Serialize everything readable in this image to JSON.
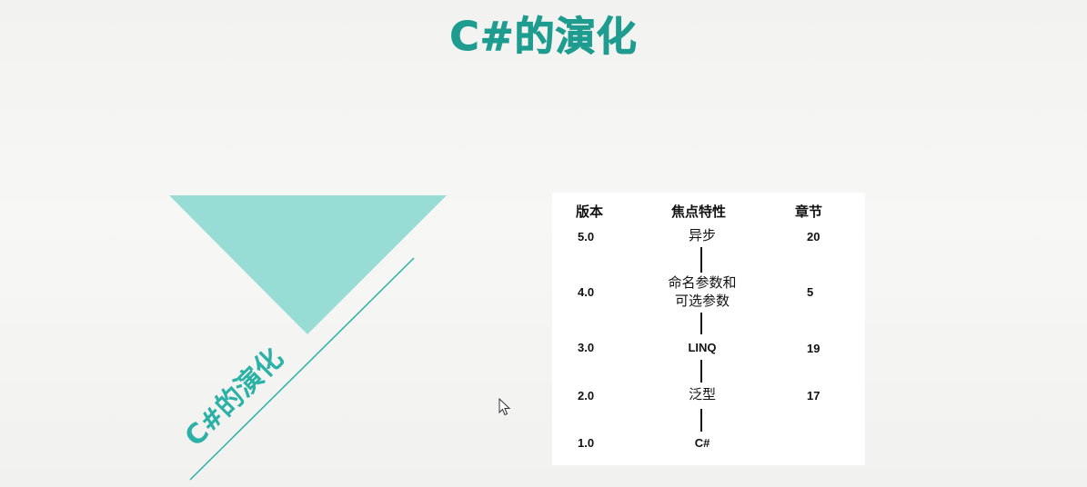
{
  "slide": {
    "title": "C#的演化",
    "rotated_title": "C#的演化"
  },
  "colors": {
    "title": "#1f9c90",
    "triangle": "#97dcd5",
    "diagonal_line": "#2bb1a6",
    "rotated_title": "#2bb1a6"
  },
  "table": {
    "headers": {
      "version": "版本",
      "feature": "焦点特性",
      "chapter": "章节"
    },
    "rows": [
      {
        "version": "5.0",
        "feature": "异步",
        "feature_line2": "",
        "chapter": "20"
      },
      {
        "version": "4.0",
        "feature": "命名参数和",
        "feature_line2": "可选参数",
        "chapter": "5"
      },
      {
        "version": "3.0",
        "feature": "LINQ",
        "feature_line2": "",
        "chapter": "19"
      },
      {
        "version": "2.0",
        "feature": "泛型",
        "feature_line2": "",
        "chapter": "17"
      },
      {
        "version": "1.0",
        "feature": "C#",
        "feature_line2": "",
        "chapter": ""
      }
    ]
  },
  "icons": {
    "cursor": "mouse-pointer-icon"
  }
}
